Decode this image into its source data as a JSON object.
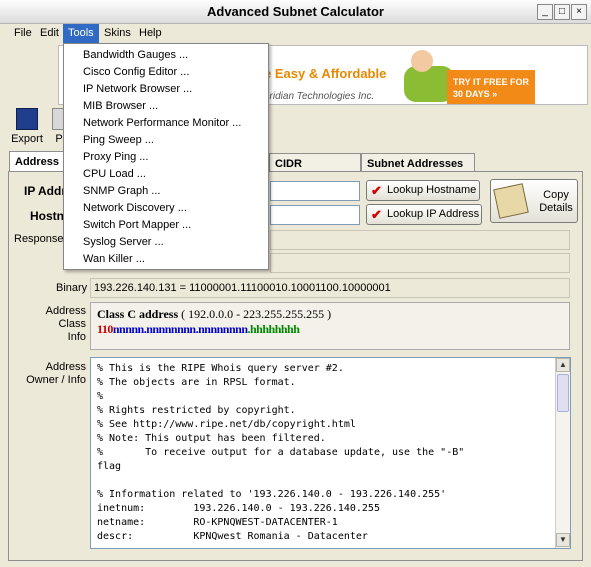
{
  "window": {
    "title": "Advanced Subnet Calculator",
    "min_glyph": "_",
    "max_glyph": "□",
    "close_glyph": "×"
  },
  "menubar": {
    "items": [
      "File",
      "Edit",
      "Tools",
      "Skins",
      "Help"
    ]
  },
  "tools_menu": {
    "items": [
      "Bandwidth Gauges ...",
      "Cisco Config Editor ...",
      "IP Network Browser ...",
      "MIB Browser ...",
      "Network Performance Monitor ...",
      "Ping Sweep ...",
      "Proxy Ping ...",
      "CPU Load ...",
      "SNMP Graph ...",
      "Network Discovery ...",
      "Switch Port Mapper ...",
      "Syslog Server ...",
      "Wan Killer ..."
    ]
  },
  "banner": {
    "tagline": "e Easy & Affordable",
    "company": "eridian Technologies Inc.",
    "cta": "TRY IT FREE FOR 30 DAYS »"
  },
  "toolbar": {
    "export_label": "Export",
    "print_label": "P"
  },
  "tabs": [
    "Address",
    "CIDR Calculator",
    "Subnet Addresses"
  ],
  "form": {
    "ip_label": "IP Addr",
    "host_label": "Hostn",
    "response_label": "Response",
    "ip_value": "",
    "host_value": "",
    "lookup_hostname": "Lookup Hostname",
    "lookup_ip": "Lookup IP Address",
    "copy_details": "Copy Details",
    "binary_label": "Binary",
    "binary_value": "193.226.140.131 = 11000001.11100010.10001100.10000001",
    "address_class_label": "Address Class Info",
    "class_title": "Class C address",
    "class_range": " ( 192.0.0.0 - 223.255.255.255 )",
    "class_bits_prefix": "110",
    "class_bits_net": "nnnnn.nnnnnnnn.nnnnnnnn",
    "class_bits_host": ".hhhhhhhh",
    "owner_label": "Address Owner / Info",
    "whois_text": "% This is the RIPE Whois query server #2.\n% The objects are in RPSL format.\n%\n% Rights restricted by copyright.\n% See http://www.ripe.net/db/copyright.html\n% Note: This output has been filtered.\n%       To receive output for a database update, use the \"-B\"\nflag\n\n% Information related to '193.226.140.0 - 193.226.140.255'\ninetnum:        193.226.140.0 - 193.226.140.255\nnetname:        RO-KPNQWEST-DATACENTER-1\ndescr:          KPNQwest Romania - Datacenter"
  },
  "colors": {
    "menu_highlight": "#316ac5",
    "class_prefix": "#cc0000",
    "class_net": "#0000cc",
    "class_host": "#008800"
  }
}
